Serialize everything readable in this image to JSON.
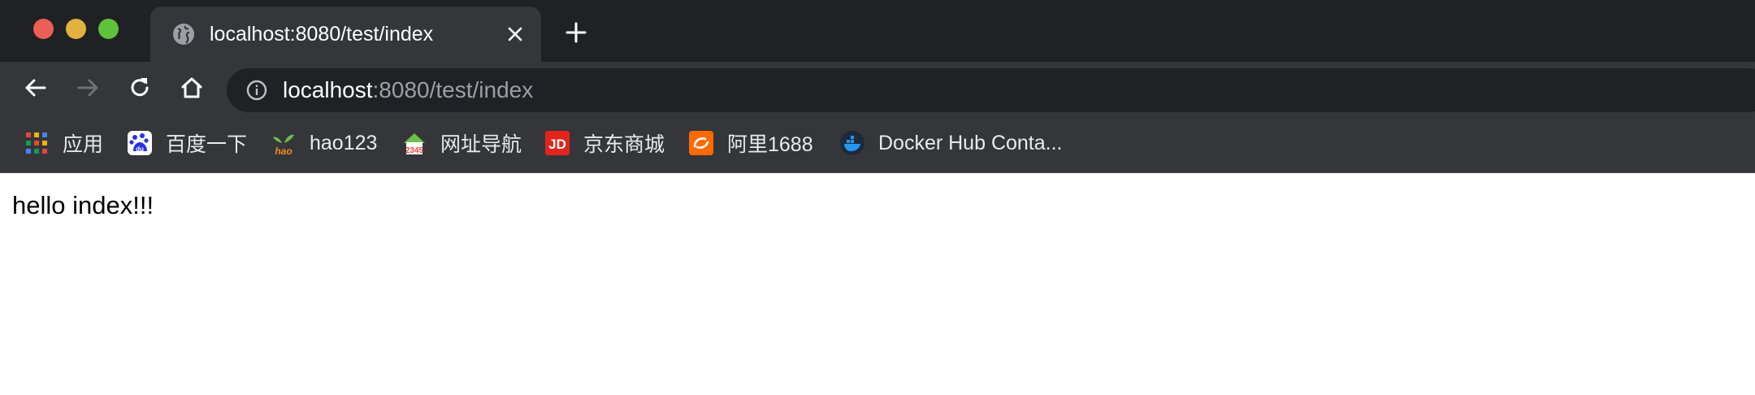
{
  "window": {
    "traffic_lights": {
      "close_color": "#ec5f57",
      "minimize_color": "#e2b13f",
      "maximize_color": "#5fc23b"
    }
  },
  "tabs": [
    {
      "title": "localhost:8080/test/index",
      "icon": "globe-icon",
      "active": true
    }
  ],
  "toolbar": {
    "back_icon": "arrow-left-icon",
    "forward_icon": "arrow-right-icon",
    "reload_icon": "reload-icon",
    "home_icon": "home-icon"
  },
  "omnibox": {
    "url_host": "localhost",
    "url_path": ":8080/test/index",
    "security_icon": "info-icon"
  },
  "bookmarks": [
    {
      "label": "应用",
      "icon": "apps-grid-icon"
    },
    {
      "label": "百度一下",
      "icon": "baidu-icon"
    },
    {
      "label": "hao123",
      "icon": "hao123-icon"
    },
    {
      "label": "网址导航",
      "icon": "2345-icon"
    },
    {
      "label": "京东商城",
      "icon": "jd-icon"
    },
    {
      "label": "阿里1688",
      "icon": "alibaba-1688-icon"
    },
    {
      "label": "Docker Hub Conta...",
      "icon": "docker-icon"
    }
  ],
  "page": {
    "body_text": "hello index!!!"
  },
  "colors": {
    "tabstrip_bg": "#202124",
    "toolbar_bg": "#35363a",
    "omnibox_bg": "#202124",
    "page_bg": "#ffffff"
  }
}
